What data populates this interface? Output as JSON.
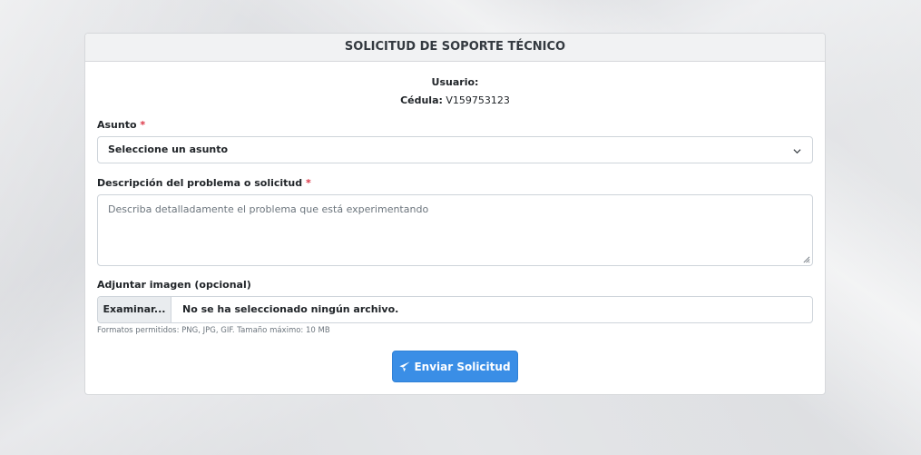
{
  "header": {
    "title": "SOLICITUD DE SOPORTE TÉCNICO"
  },
  "user": {
    "usuario_label": "Usuario:",
    "usuario_value": "",
    "cedula_label": "Cédula:",
    "cedula_value": "V159753123"
  },
  "form": {
    "asunto_label": "Asunto",
    "asunto_selected": "Seleccione un asunto",
    "descripcion_label": "Descripción del problema o solicitud",
    "descripcion_placeholder": "Describa detalladamente el problema que está experimentando",
    "required_mark": "*",
    "adjuntar_label": "Adjuntar imagen (opcional)",
    "file_button": "Examinar...",
    "file_status": "No se ha seleccionado ningún archivo.",
    "file_help": "Formatos permitidos: PNG, JPG, GIF. Tamaño máximo: 10 MB",
    "submit_label": "Enviar Solicitud"
  },
  "icons": {
    "select": "chevron-down-icon",
    "submit": "paper-plane-icon",
    "resize": "resize-grip-icon"
  },
  "colors": {
    "accent": "#3a8ee6",
    "required": "#dc3545"
  }
}
